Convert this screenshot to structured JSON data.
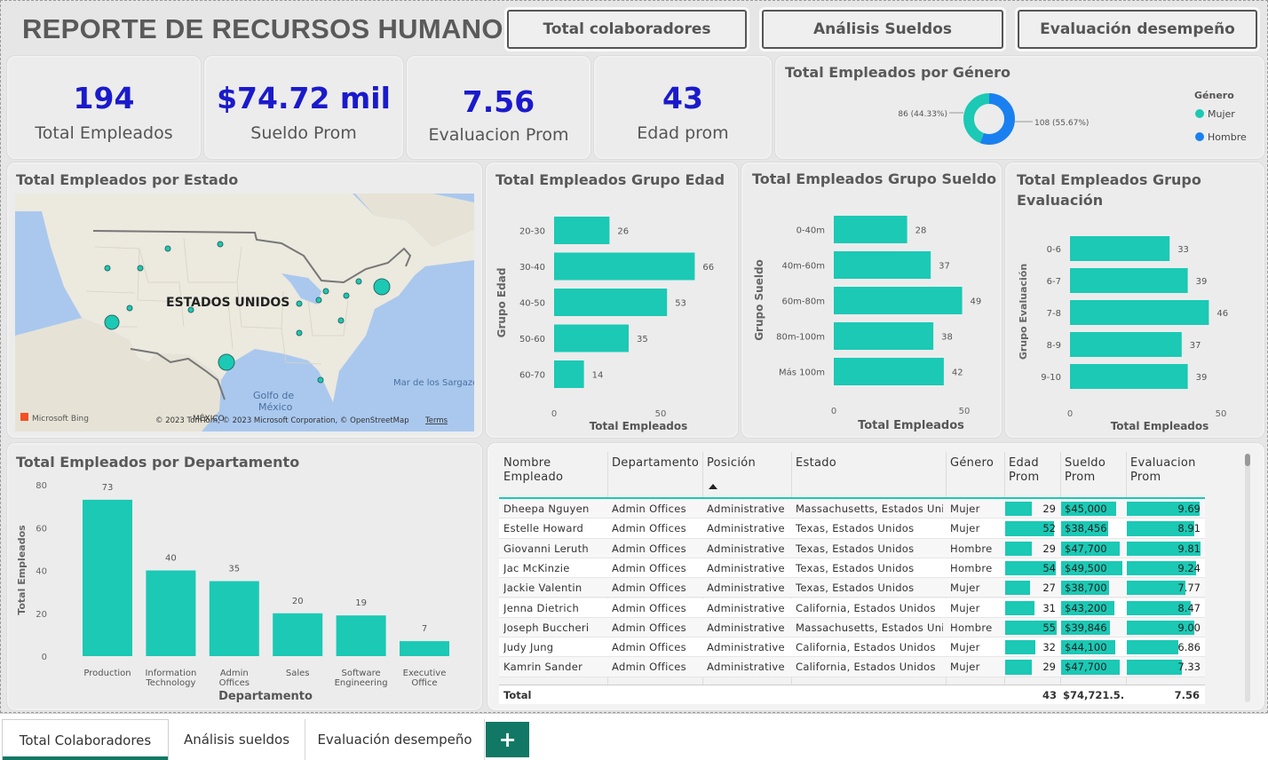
{
  "header": {
    "title": "REPORTE DE RECURSOS HUMANOS",
    "buttons": [
      "Total colaboradores",
      "Análisis Sueldos",
      "Evaluación desempeño"
    ]
  },
  "kpis": [
    {
      "value": "194",
      "label": "Total Empleados"
    },
    {
      "value": "$74.72 mil",
      "label": "Sueldo Prom"
    },
    {
      "value": "7.56",
      "label": "Evaluacion Prom"
    },
    {
      "value": "43",
      "label": "Edad prom"
    }
  ],
  "gender": {
    "title": "Total Empleados por Género",
    "legend_title": "Género",
    "label_mujer": "86 (44.33%)",
    "label_hombre": "108 (55.67%)"
  },
  "map": {
    "title": "Total Empleados por Estado",
    "country_label": "ESTADOS UNIDOS",
    "gulf_label_1": "Golfo de",
    "gulf_label_2": "México",
    "sea_label": "Mar de los Sargazo",
    "mexico_label": "MÉXICO",
    "bing": "Microsoft Bing",
    "copyright": "© 2023 TomTom, © 2023 Microsoft Corporation, © OpenStreetMap",
    "terms": "Terms"
  },
  "edad": {
    "title": "Total Empleados Grupo Edad",
    "yaxis": "Grupo Edad",
    "xaxis": "Total Empleados",
    "tick0": "0",
    "tick50": "50"
  },
  "sueldo": {
    "title": "Total Empleados Grupo Sueldo",
    "yaxis": "Grupo Sueldo",
    "xaxis": "Total Empleados",
    "tick0": "0",
    "tick50": "50"
  },
  "evaluacion": {
    "title1": "Total Empleados Grupo",
    "title2": "Evaluación",
    "yaxis": "Grupo Evaluación",
    "xaxis": "Total Empleados",
    "tick0": "0",
    "tick50": "50"
  },
  "departamento": {
    "title": "Total Empleados por Departamento",
    "yaxis": "Total Empleados",
    "xaxis": "Departamento"
  },
  "chart_data": [
    {
      "type": "pie",
      "title": "Total Empleados por Género",
      "legend_title": "Género",
      "legend_placement": "right",
      "categories": [
        "Mujer",
        "Hombre"
      ],
      "values": [
        86,
        108
      ],
      "colors": [
        "#1bc9b5",
        "#1a80f0"
      ]
    },
    {
      "type": "bar",
      "orientation": "horizontal",
      "title": "Total Empleados Grupo Edad",
      "xlabel": "Total Empleados",
      "ylabel": "Grupo Edad",
      "categories": [
        "20-30",
        "30-40",
        "40-50",
        "50-60",
        "60-70"
      ],
      "values": [
        26,
        66,
        53,
        35,
        14
      ],
      "xlim": [
        0,
        70
      ],
      "color": "#1bc9b5"
    },
    {
      "type": "bar",
      "orientation": "horizontal",
      "title": "Total Empleados Grupo Sueldo",
      "xlabel": "Total Empleados",
      "ylabel": "Grupo Sueldo",
      "categories": [
        "0-40m",
        "40m-60m",
        "60m-80m",
        "80m-100m",
        "Más 100m"
      ],
      "values": [
        28,
        37,
        49,
        38,
        42
      ],
      "xlim": [
        0,
        50
      ],
      "color": "#1bc9b5"
    },
    {
      "type": "bar",
      "orientation": "horizontal",
      "title": "Total Empleados Grupo Evaluación",
      "xlabel": "Total Empleados",
      "ylabel": "Grupo Evaluación",
      "categories": [
        "0-6",
        "6-7",
        "7-8",
        "8-9",
        "9-10"
      ],
      "values": [
        33,
        39,
        46,
        37,
        39
      ],
      "xlim": [
        0,
        50
      ],
      "color": "#1bc9b5"
    },
    {
      "type": "bar",
      "title": "Total Empleados por Departamento",
      "xlabel": "Departamento",
      "ylabel": "Total Empleados",
      "categories": [
        [
          "Production"
        ],
        [
          "Information",
          "Technology"
        ],
        [
          "Admin",
          "Offices"
        ],
        [
          "Sales"
        ],
        [
          "Software",
          "Engineering"
        ],
        [
          "Executive",
          "Office"
        ]
      ],
      "values": [
        73,
        40,
        35,
        20,
        19,
        7
      ],
      "ylim": [
        0,
        80
      ],
      "yticks": [
        "0",
        "20",
        "40",
        "60",
        "80"
      ],
      "color": "#1bc9b5"
    }
  ],
  "table": {
    "columns": [
      [
        "Nombre",
        "Empleado"
      ],
      [
        "Departamento"
      ],
      [
        "Posición"
      ],
      [
        "Estado"
      ],
      [
        "Género"
      ],
      [
        "Edad",
        "Prom"
      ],
      [
        "Sueldo",
        "Prom"
      ],
      [
        "Evaluacion",
        "Prom"
      ]
    ],
    "rows": [
      {
        "name": "Dheepa Nguyen",
        "dept": "Admin Offices",
        "pos": "Administrative I",
        "estado": "Massachusetts, Estados Uni...",
        "genero": "Mujer",
        "edad": "29",
        "edad_v": 29,
        "sueldo": "$45,000",
        "sueldo_v": 45000,
        "eval": "9.69",
        "eval_v": 9.69
      },
      {
        "name": "Estelle Howard",
        "dept": "Admin Offices",
        "pos": "Administrative I",
        "estado": "Texas, Estados Unidos",
        "genero": "Mujer",
        "edad": "52",
        "edad_v": 52,
        "sueldo": "$38,456",
        "sueldo_v": 38456,
        "eval": "8.91",
        "eval_v": 8.91
      },
      {
        "name": "Giovanni Leruth",
        "dept": "Admin Offices",
        "pos": "Administrative I",
        "estado": "Texas, Estados Unidos",
        "genero": "Hombre",
        "edad": "29",
        "edad_v": 29,
        "sueldo": "$47,700",
        "sueldo_v": 47700,
        "eval": "9.81",
        "eval_v": 9.81
      },
      {
        "name": "Jac McKinzie",
        "dept": "Admin Offices",
        "pos": "Administrative I",
        "estado": "Texas, Estados Unidos",
        "genero": "Hombre",
        "edad": "54",
        "edad_v": 54,
        "sueldo": "$49,500",
        "sueldo_v": 49500,
        "eval": "9.24",
        "eval_v": 9.24
      },
      {
        "name": "Jackie Valentin",
        "dept": "Admin Offices",
        "pos": "Administrative I",
        "estado": "Texas, Estados Unidos",
        "genero": "Mujer",
        "edad": "27",
        "edad_v": 27,
        "sueldo": "$38,700",
        "sueldo_v": 38700,
        "eval": "7.77",
        "eval_v": 7.77
      },
      {
        "name": "Jenna Dietrich",
        "dept": "Admin Offices",
        "pos": "Administrative I",
        "estado": "California, Estados Unidos",
        "genero": "Mujer",
        "edad": "31",
        "edad_v": 31,
        "sueldo": "$43,200",
        "sueldo_v": 43200,
        "eval": "8.47",
        "eval_v": 8.47
      },
      {
        "name": "Joseph Buccheri",
        "dept": "Admin Offices",
        "pos": "Administrative I",
        "estado": "Massachusetts, Estados Uni...",
        "genero": "Hombre",
        "edad": "55",
        "edad_v": 55,
        "sueldo": "$39,846",
        "sueldo_v": 39846,
        "eval": "9.00",
        "eval_v": 9.0
      },
      {
        "name": "Judy Jung",
        "dept": "Admin Offices",
        "pos": "Administrative I",
        "estado": "California, Estados Unidos",
        "genero": "Mujer",
        "edad": "32",
        "edad_v": 32,
        "sueldo": "$44,100",
        "sueldo_v": 44100,
        "eval": "6.86",
        "eval_v": 6.86
      },
      {
        "name": "Kamrin Sander",
        "dept": "Admin Offices",
        "pos": "Administrative I",
        "estado": "California, Estados Unidos",
        "genero": "Mujer",
        "edad": "29",
        "edad_v": 29,
        "sueldo": "$47,700",
        "sueldo_v": 47700,
        "eval": "7.33",
        "eval_v": 7.33
      }
    ],
    "total": {
      "label": "Total",
      "edad": "43",
      "sueldo": "$74,721.5...",
      "eval": "7.56"
    }
  },
  "tabs": [
    {
      "label": "Total Colaboradores",
      "active": true
    },
    {
      "label": "Análisis sueldos",
      "active": false
    },
    {
      "label": "Evaluación desempeño",
      "active": false
    }
  ],
  "add_tab_glyph": "+",
  "colors": {
    "accent": "#1bc9b5",
    "hombre": "#1a80f0",
    "kpi": "#1a1acc",
    "add_tab": "#117865"
  }
}
